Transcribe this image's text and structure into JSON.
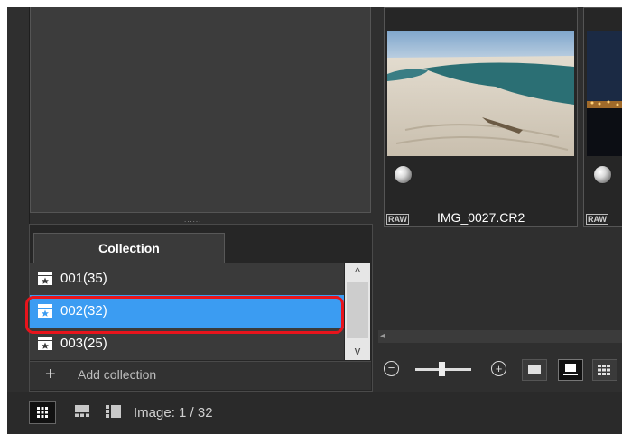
{
  "collection_panel": {
    "tab_label": "Collection",
    "items": [
      {
        "label": "001(35)",
        "selected": false
      },
      {
        "label": "002(32)",
        "selected": true
      },
      {
        "label": "003(25)",
        "selected": false
      }
    ],
    "add_label": "Add collection"
  },
  "status": {
    "image_count": "Image: 1 / 32"
  },
  "thumbnails": [
    {
      "badge": "RAW",
      "filename": "IMG_0027.CR2"
    },
    {
      "badge": "RAW",
      "filename": ""
    }
  ],
  "icons": {
    "scroll_up": "^",
    "scroll_down": "v",
    "add": "+",
    "zoom_out": "−",
    "zoom_in": "+",
    "grip": "......"
  },
  "colors": {
    "selection": "#3b9cf2",
    "highlight_outline": "#e8141c",
    "background": "#2f2f2f"
  }
}
